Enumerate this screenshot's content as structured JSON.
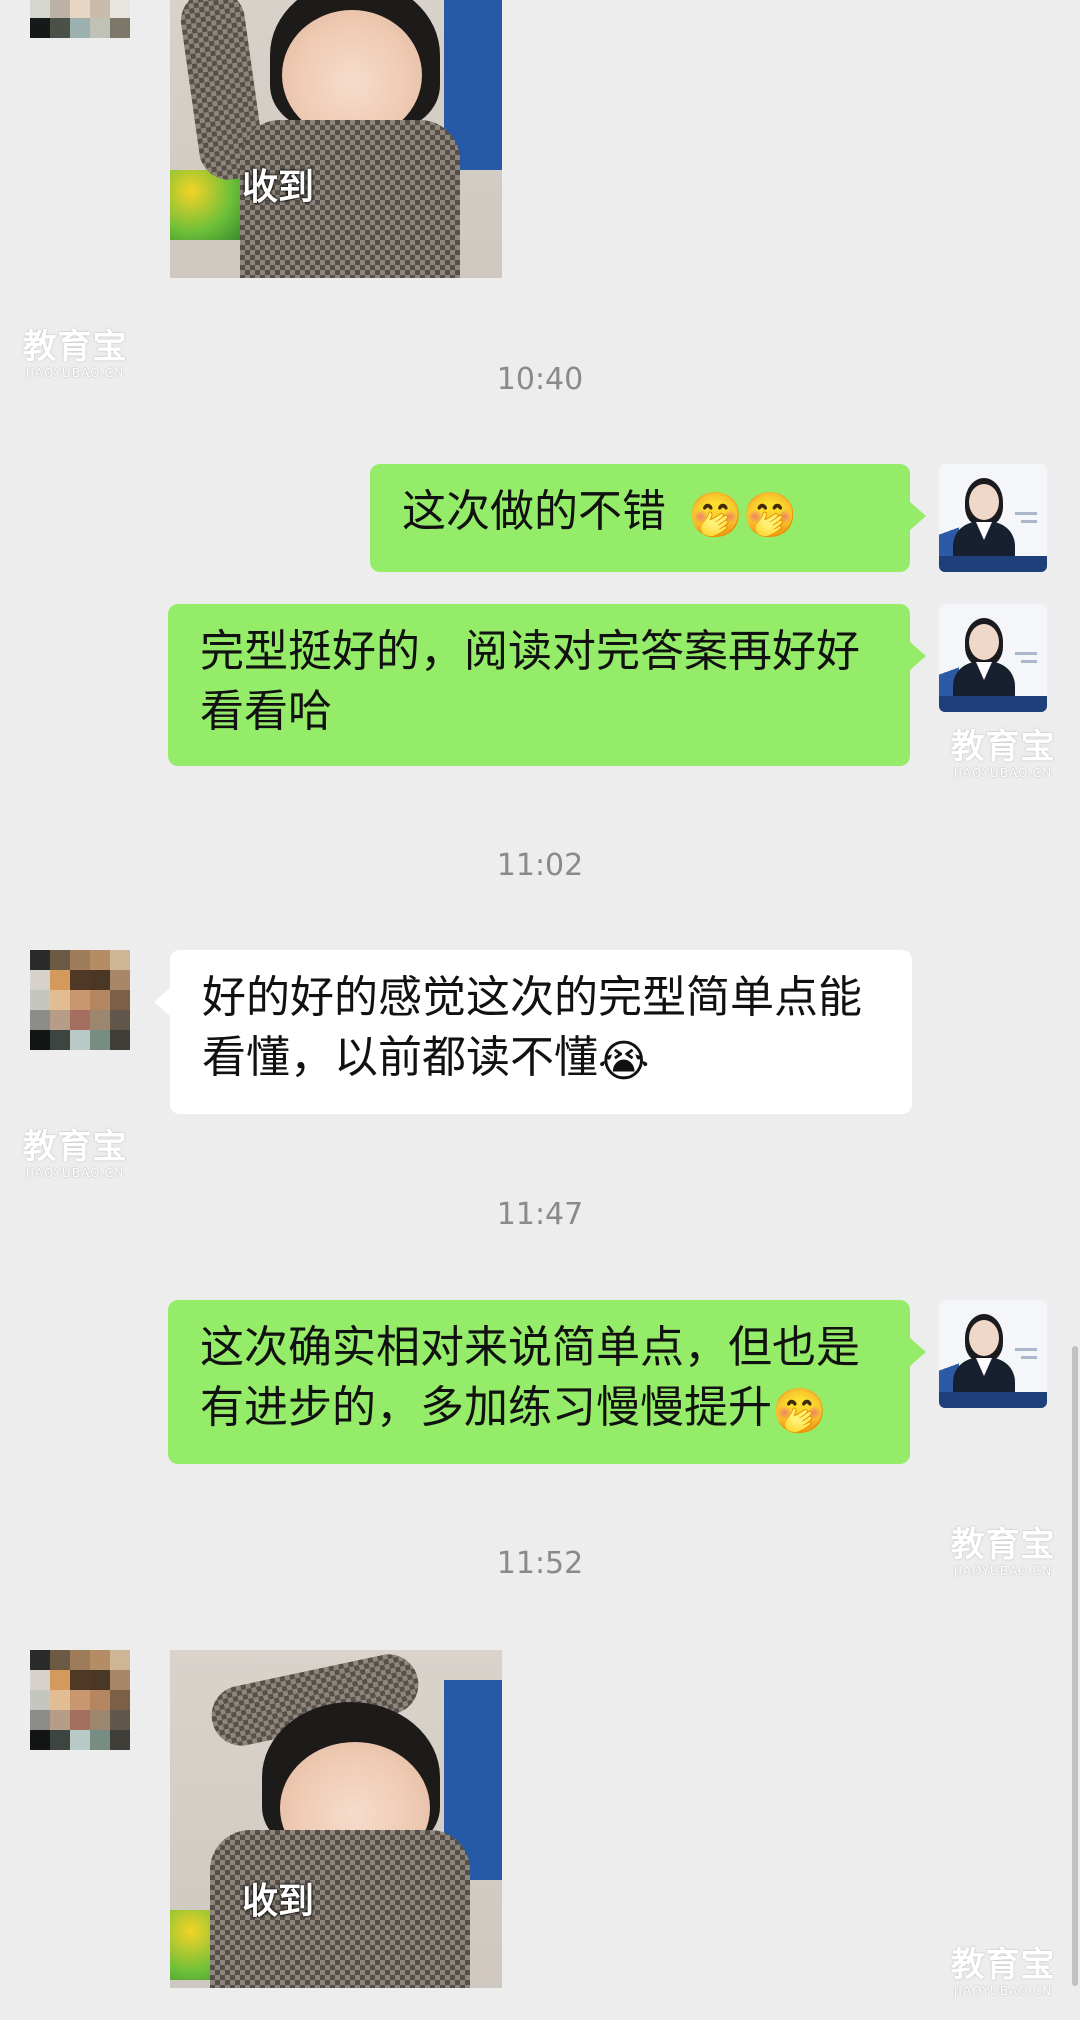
{
  "watermark": {
    "cn": "教育宝",
    "en": "JIAOYUBAO.CN"
  },
  "timestamps": [
    "10:40",
    "11:02",
    "11:47",
    "11:52"
  ],
  "sticker": {
    "caption": "收到"
  },
  "messages": [
    {
      "sender": "teacher",
      "text": "这次做的不错",
      "emoji": "🤭🤭"
    },
    {
      "sender": "teacher",
      "text": "完型挺好的，阅读对完答案再好好看看哈"
    },
    {
      "sender": "student",
      "text": "好的好的感觉这次的完型简单点能看懂，以前都读不懂",
      "emoji": "😭"
    },
    {
      "sender": "teacher",
      "text": "这次确实相对来说简单点，但也是有进步的，多加练习慢慢提升",
      "emoji": "🤭"
    }
  ],
  "colors": {
    "bubble_sent": "#95ec69",
    "bubble_received": "#ffffff",
    "background": "#ededed"
  }
}
